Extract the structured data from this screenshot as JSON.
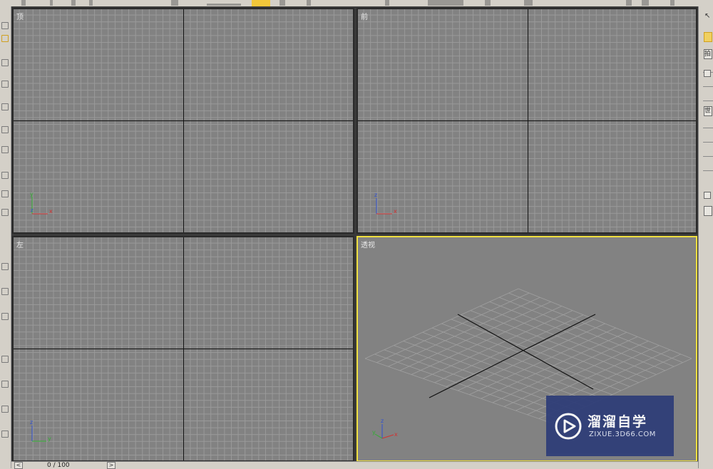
{
  "viewports": {
    "top": {
      "label": "顶"
    },
    "front": {
      "label": "前"
    },
    "left": {
      "label": "左"
    },
    "perspective": {
      "label": "透视"
    }
  },
  "axes": {
    "x": "x",
    "y": "y",
    "z": "z"
  },
  "time_slider": {
    "frame": "0 / 100",
    "prev": "<",
    "next": ">"
  },
  "command_panel": {
    "text_1": "拍",
    "text_2": "世"
  },
  "watermark": {
    "title": "溜溜自学",
    "url": "ZIXUE.3D66.COM"
  },
  "colors": {
    "active_border": "#f0e040",
    "x_axis": "#d43030",
    "y_axis": "#30b030",
    "z_axis": "#3050d0",
    "watermark_bg": "#2e3d78"
  }
}
